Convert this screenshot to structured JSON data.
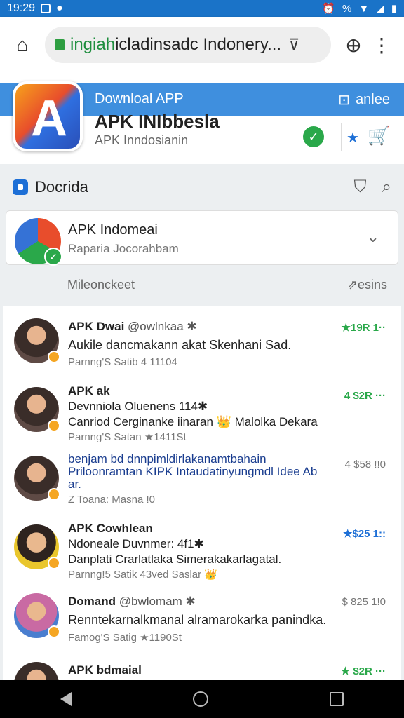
{
  "status_bar": {
    "time": "19:29",
    "battery": "%"
  },
  "browser": {
    "url_domain": "ingiah",
    "url_path": "icladinsadc Indonery...",
    "home_icon": "home-icon",
    "search_icon": "search-icon",
    "menu_icon": "more-vert-icon"
  },
  "app_header": {
    "download_label": "Downloal APP",
    "login_label": "anlee",
    "app_title": "APK INIbbesla",
    "app_subtitle": "APK Inndosianin"
  },
  "section": {
    "title": "Docrida"
  },
  "featured_card": {
    "title": "APK Indomeai",
    "subtitle": "Raparia Jocorahbam"
  },
  "filter_row": {
    "left": "Mileonckeet",
    "right": "esins"
  },
  "list_items": [
    {
      "head": "APK Dwai",
      "user": "@owlnkaa ✱",
      "line2": "Aukile dancmakann akat Skenhani Sad.",
      "line3": "Parnng'S Satib 4 11104",
      "meta": "★19R 1··",
      "meta_style": "green"
    },
    {
      "head": "APK ak",
      "user": "",
      "line2": "Devnniola Oluenens 114✱",
      "line2b": "Canriod Cerginanke iinaran 👑 Malolka Dekara",
      "line3": "Parnng'S Satan ★1411St",
      "meta": "4 $2R ···",
      "meta_style": "green"
    },
    {
      "head": "",
      "user": "",
      "line2": "benjam bd dnnpimldirlakanamtbahain Priloonramtan KIPK Intaudatinyungmdl Idee Ab ar.",
      "line3": "Z Toana: Masna !0",
      "meta": "4 $58 !!0",
      "meta_style": "grey"
    },
    {
      "head": "APK Cowhlean",
      "user": "",
      "line2": "Ndoneale Duvnmer: 4f1✱",
      "line2b": "Danplati Crarlatlaka Simerakakarlagatal.",
      "line3": "Parnng!5 Satik 43ved Saslar 👑",
      "meta": "★$25 1::",
      "meta_style": "blue"
    },
    {
      "head": "Domand",
      "user": "@bwlomam ✱",
      "line2": "Renntekarnalkmanal alramarokarka panindka.",
      "line3": "Famog'S Satig ★1190St",
      "meta": "$ 825 1!0",
      "meta_style": "grey"
    },
    {
      "head": "APK bdmaial",
      "user": "",
      "line2": "",
      "line3": "",
      "meta": "★ $2R ···",
      "meta_style": "green"
    }
  ]
}
